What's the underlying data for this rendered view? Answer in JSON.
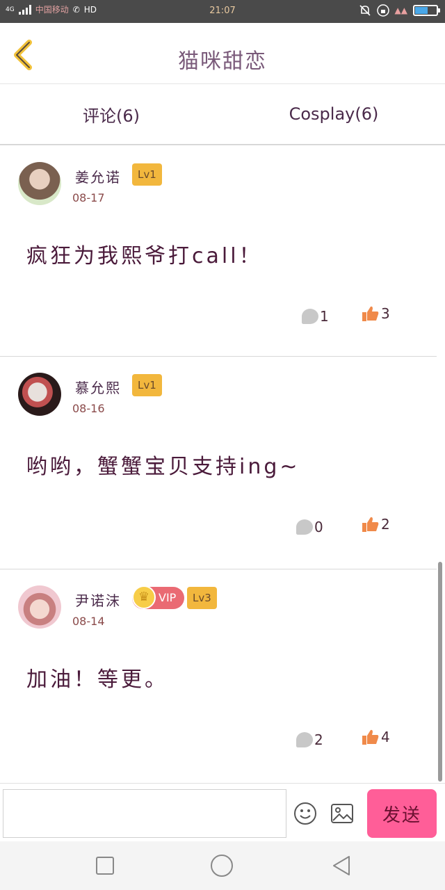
{
  "status_bar": {
    "network": "4G",
    "carrier": "中国移动",
    "hd": "HD",
    "time": "21:07",
    "battery_percent": 60,
    "colors": {
      "background": "#4a4a4a",
      "battery": "#4aa8e8"
    }
  },
  "header": {
    "back_icon": "chevron-left-icon",
    "title": "猫咪甜恋"
  },
  "tabs": [
    {
      "label": "评论(6)"
    },
    {
      "label": "Cosplay(6)"
    }
  ],
  "comments": [
    {
      "user": "姜允诺",
      "level": "Lv1",
      "vip": "",
      "date": "08-17",
      "text": "疯狂为我熙爷打call！",
      "replies": "1",
      "likes": "3"
    },
    {
      "user": "慕允熙",
      "level": "Lv1",
      "vip": "",
      "date": "08-16",
      "text": "哟哟，蟹蟹宝贝支持ing~",
      "replies": "0",
      "likes": "2"
    },
    {
      "user": "尹诺沫",
      "level": "Lv3",
      "vip": "VIP",
      "date": "08-14",
      "text": "加油！等更。",
      "replies": "2",
      "likes": "4"
    }
  ],
  "input_bar": {
    "placeholder": "",
    "emoji_icon": "smiley-icon",
    "image_icon": "image-icon",
    "send_label": "发送",
    "colors": {
      "send": "#ff5e98"
    }
  },
  "nav_bar": {
    "icons": [
      "recents-icon",
      "home-icon",
      "back-triangle-icon"
    ]
  },
  "colors": {
    "level_badge": "#f2b73d",
    "vip_badge": "#ea6a73",
    "like": "#f08a4a",
    "reply": "#c8c8c8"
  }
}
